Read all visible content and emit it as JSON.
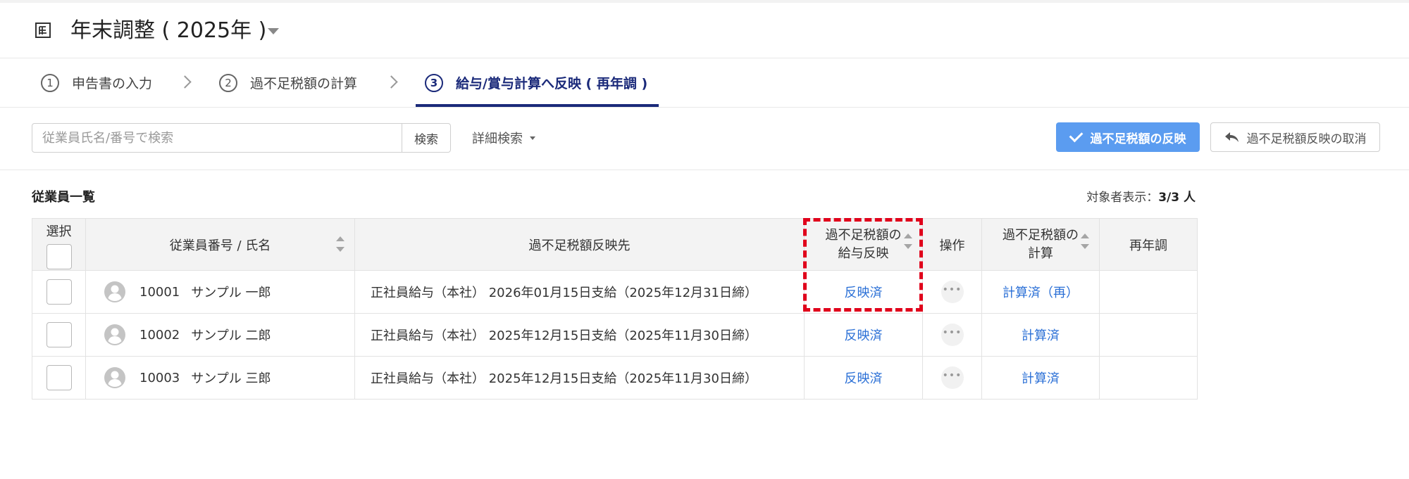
{
  "colors": {
    "accent": "#1b2a7a",
    "primary_button": "#5b9cf0",
    "link": "#2a6fd6",
    "highlight": "#e0001b"
  },
  "header": {
    "icon": "calendar-year-icon",
    "title": "年末調整 ( 2025年 )"
  },
  "steps": [
    {
      "number": "1",
      "label": "申告書の入力",
      "active": false
    },
    {
      "number": "2",
      "label": "過不足税額の計算",
      "active": false
    },
    {
      "number": "3",
      "label": "給与/賞与計算へ反映 ( 再年調 )",
      "active": true
    }
  ],
  "toolbar": {
    "search_placeholder": "従業員氏名/番号で検索",
    "search_value": "",
    "search_button": "検索",
    "detail_search": "詳細検索",
    "reflect_button": "過不足税額の反映",
    "cancel_button": "過不足税額反映の取消"
  },
  "list": {
    "title": "従業員一覧",
    "count_label": "対象者表示：",
    "count_value": "3/3 人",
    "columns": {
      "select": "選択",
      "employee": "従業員番号 / 氏名",
      "destination": "過不足税額反映先",
      "salary_reflect_line1": "過不足税額の",
      "salary_reflect_line2": "給与反映",
      "ops": "操作",
      "calc_line1": "過不足税額の",
      "calc_line2": "計算",
      "readjust": "再年調"
    },
    "rows": [
      {
        "no": "10001",
        "name": "サンプル 一郎",
        "destination": "正社員給与（本社） 2026年01月15日支給（2025年12月31日締）",
        "salary_reflect": "反映済",
        "calc": "計算済（再）",
        "readjust": ""
      },
      {
        "no": "10002",
        "name": "サンプル 二郎",
        "destination": "正社員給与（本社） 2025年12月15日支給（2025年11月30日締）",
        "salary_reflect": "反映済",
        "calc": "計算済",
        "readjust": ""
      },
      {
        "no": "10003",
        "name": "サンプル 三郎",
        "destination": "正社員給与（本社） 2025年12月15日支給（2025年11月30日締）",
        "salary_reflect": "反映済",
        "calc": "計算済",
        "readjust": ""
      }
    ]
  }
}
